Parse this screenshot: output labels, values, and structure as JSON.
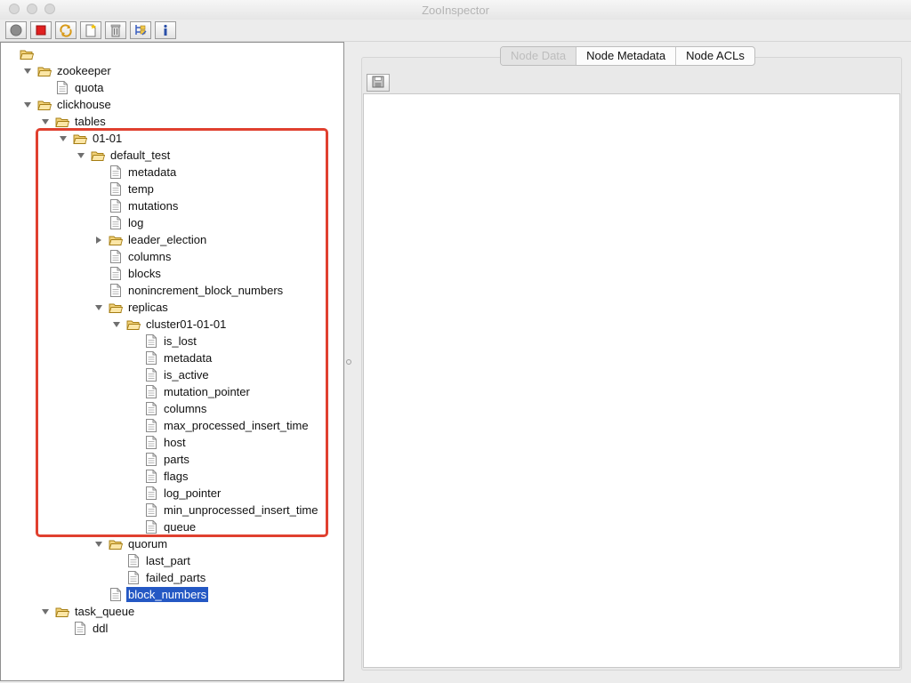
{
  "window": {
    "title": "ZooInspector"
  },
  "toolbar": {
    "buttons": [
      {
        "name": "connect",
        "icon": "connect-icon"
      },
      {
        "name": "disconnect",
        "icon": "disconnect-icon"
      },
      {
        "name": "refresh",
        "icon": "refresh-icon"
      },
      {
        "name": "add-node",
        "icon": "add-node-icon"
      },
      {
        "name": "delete-node",
        "icon": "delete-icon"
      },
      {
        "name": "node-viewers",
        "icon": "node-viewers-icon"
      },
      {
        "name": "about",
        "icon": "info-icon"
      }
    ]
  },
  "tree": {
    "selected": "block_numbers",
    "nodes": [
      {
        "label": "",
        "type": "folder",
        "expanded": true,
        "depth": 0,
        "arrow": "none"
      },
      {
        "label": "zookeeper",
        "type": "folder",
        "expanded": true,
        "depth": 1,
        "arrow": "down"
      },
      {
        "label": "quota",
        "type": "file",
        "depth": 2,
        "arrow": "none"
      },
      {
        "label": "clickhouse",
        "type": "folder",
        "expanded": true,
        "depth": 1,
        "arrow": "down"
      },
      {
        "label": "tables",
        "type": "folder",
        "expanded": true,
        "depth": 2,
        "arrow": "down"
      },
      {
        "label": "01-01",
        "type": "folder",
        "expanded": true,
        "depth": 3,
        "arrow": "down"
      },
      {
        "label": "default_test",
        "type": "folder",
        "expanded": true,
        "depth": 4,
        "arrow": "down"
      },
      {
        "label": "metadata",
        "type": "file",
        "depth": 5,
        "arrow": "none"
      },
      {
        "label": "temp",
        "type": "file",
        "depth": 5,
        "arrow": "none"
      },
      {
        "label": "mutations",
        "type": "file",
        "depth": 5,
        "arrow": "none"
      },
      {
        "label": "log",
        "type": "file",
        "depth": 5,
        "arrow": "none"
      },
      {
        "label": "leader_election",
        "type": "folder",
        "expanded": false,
        "depth": 5,
        "arrow": "right"
      },
      {
        "label": "columns",
        "type": "file",
        "depth": 5,
        "arrow": "none"
      },
      {
        "label": "blocks",
        "type": "file",
        "depth": 5,
        "arrow": "none"
      },
      {
        "label": "nonincrement_block_numbers",
        "type": "file",
        "depth": 5,
        "arrow": "none"
      },
      {
        "label": "replicas",
        "type": "folder",
        "expanded": true,
        "depth": 5,
        "arrow": "down"
      },
      {
        "label": "cluster01-01-01",
        "type": "folder",
        "expanded": true,
        "depth": 6,
        "arrow": "down"
      },
      {
        "label": "is_lost",
        "type": "file",
        "depth": 7,
        "arrow": "none"
      },
      {
        "label": "metadata",
        "type": "file",
        "depth": 7,
        "arrow": "none"
      },
      {
        "label": "is_active",
        "type": "file",
        "depth": 7,
        "arrow": "none"
      },
      {
        "label": "mutation_pointer",
        "type": "file",
        "depth": 7,
        "arrow": "none"
      },
      {
        "label": "columns",
        "type": "file",
        "depth": 7,
        "arrow": "none"
      },
      {
        "label": "max_processed_insert_time",
        "type": "file",
        "depth": 7,
        "arrow": "none"
      },
      {
        "label": "host",
        "type": "file",
        "depth": 7,
        "arrow": "none"
      },
      {
        "label": "parts",
        "type": "file",
        "depth": 7,
        "arrow": "none"
      },
      {
        "label": "flags",
        "type": "file",
        "depth": 7,
        "arrow": "none"
      },
      {
        "label": "log_pointer",
        "type": "file",
        "depth": 7,
        "arrow": "none"
      },
      {
        "label": "min_unprocessed_insert_time",
        "type": "file",
        "depth": 7,
        "arrow": "none"
      },
      {
        "label": "queue",
        "type": "file",
        "depth": 7,
        "arrow": "none"
      },
      {
        "label": "quorum",
        "type": "folder",
        "expanded": true,
        "depth": 5,
        "arrow": "down"
      },
      {
        "label": "last_part",
        "type": "file",
        "depth": 6,
        "arrow": "none"
      },
      {
        "label": "failed_parts",
        "type": "file",
        "depth": 6,
        "arrow": "none"
      },
      {
        "label": "block_numbers",
        "type": "file",
        "depth": 5,
        "arrow": "none",
        "selected": true
      },
      {
        "label": "task_queue",
        "type": "folder",
        "expanded": true,
        "depth": 2,
        "arrow": "down"
      },
      {
        "label": "ddl",
        "type": "file",
        "depth": 3,
        "arrow": "none"
      }
    ]
  },
  "right_panel": {
    "tabs": [
      {
        "label": "Node Data",
        "selected": true
      },
      {
        "label": "Node Metadata",
        "selected": false
      },
      {
        "label": "Node ACLs",
        "selected": false
      }
    ],
    "node_data_text": ""
  },
  "colors": {
    "selection": "#2458c4",
    "highlight_box": "#e0402f",
    "folder": "#f2d27a",
    "disconnect_red": "#e02020"
  }
}
